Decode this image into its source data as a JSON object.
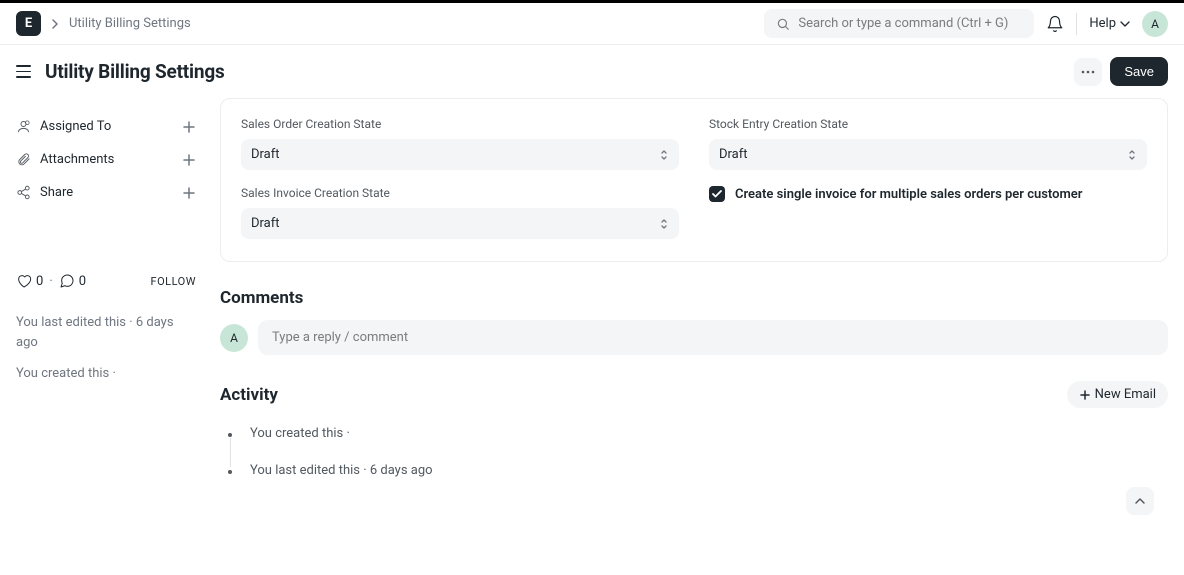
{
  "app_logo_letter": "E",
  "breadcrumb": "Utility Billing Settings",
  "search": {
    "placeholder": "Search or type a command (Ctrl + G)"
  },
  "help_label": "Help",
  "user_initial": "A",
  "page_title": "Utility Billing Settings",
  "save_label": "Save",
  "sidebar": {
    "assigned_label": "Assigned To",
    "attachments_label": "Attachments",
    "share_label": "Share",
    "likes": "0",
    "comments_count": "0",
    "follow_label": "FOLLOW",
    "meta": [
      "You last edited this · 6 days ago",
      "You created this ·"
    ]
  },
  "form": {
    "sales_order_state_label": "Sales Order Creation State",
    "sales_order_state_value": "Draft",
    "sales_invoice_state_label": "Sales Invoice Creation State",
    "sales_invoice_state_value": "Draft",
    "stock_entry_state_label": "Stock Entry Creation State",
    "stock_entry_state_value": "Draft",
    "single_invoice_label": "Create single invoice for multiple sales orders per customer",
    "single_invoice_checked": true
  },
  "comments": {
    "heading": "Comments",
    "placeholder": "Type a reply / comment"
  },
  "activity": {
    "heading": "Activity",
    "new_email_label": "New Email",
    "items": [
      "You created this ·",
      "You last edited this · 6 days ago"
    ]
  }
}
